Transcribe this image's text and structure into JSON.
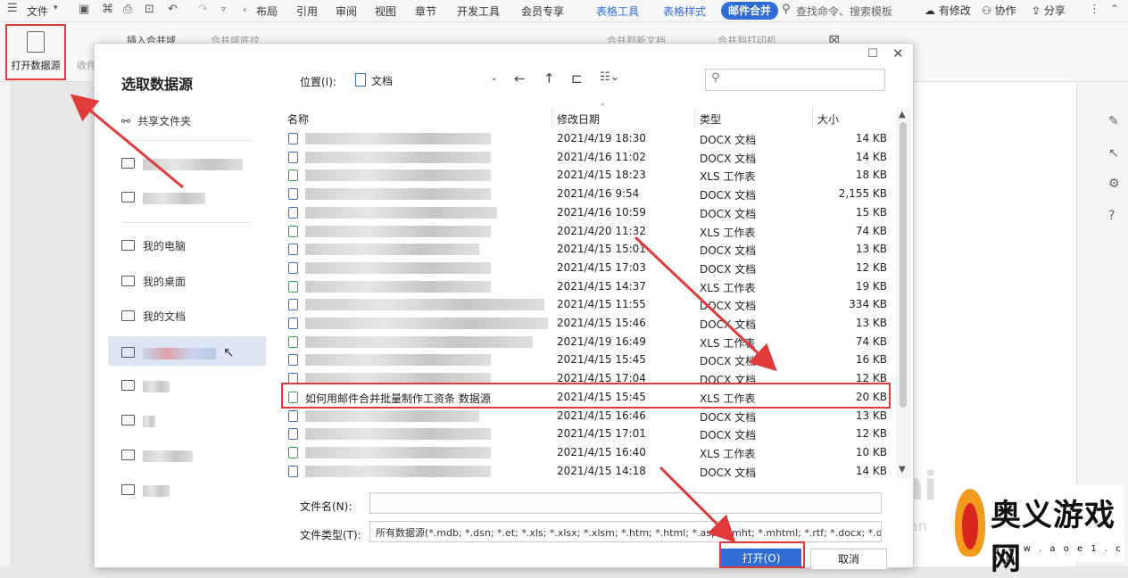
{
  "menubar": {
    "file": "文件",
    "items": [
      "布局",
      "引用",
      "审阅",
      "视图",
      "章节",
      "开发工具",
      "会员专享"
    ],
    "context_tabs": [
      "表格工具",
      "表格样式"
    ],
    "active_tab": "邮件合并",
    "search_placeholder": "查找命令、搜索模板",
    "modified": "有修改",
    "collab": "协作",
    "share": "分享"
  },
  "ribbon": {
    "open_datasource": "打开数据源",
    "collect": "收件",
    "insert_merge_field": "插入合并域",
    "merge_field_shading": "合并域底纹",
    "merge_new_doc": "合并到新文档",
    "merge_printer": "合并到打印机"
  },
  "dialog": {
    "title": "选取数据源",
    "location_label": "位置(I):",
    "location_value": "文档",
    "sidebar": {
      "shared": "共享文件夹",
      "my_computer": "我的电脑",
      "my_desktop": "我的桌面",
      "my_documents": "我的文档"
    },
    "columns": {
      "name": "名称",
      "date": "修改日期",
      "type": "类型",
      "size": "大小"
    },
    "files": [
      {
        "name": "",
        "date": "2021/4/19 18:30",
        "type": "DOCX 文档",
        "size": "14 KB",
        "kind": "docx"
      },
      {
        "name": "",
        "date": "2021/4/16 11:02",
        "type": "DOCX 文档",
        "size": "14 KB",
        "kind": "docx"
      },
      {
        "name": "",
        "date": "2021/4/15 18:23",
        "type": "XLS 工作表",
        "size": "18 KB",
        "kind": "xls"
      },
      {
        "name": "",
        "date": "2021/4/16 9:54",
        "type": "DOCX 文档",
        "size": "2,155 KB",
        "kind": "docx"
      },
      {
        "name": "",
        "date": "2021/4/16 10:59",
        "type": "DOCX 文档",
        "size": "15 KB",
        "kind": "docx"
      },
      {
        "name": "",
        "date": "2021/4/20 11:32",
        "type": "XLS 工作表",
        "size": "74 KB",
        "kind": "xls"
      },
      {
        "name": "",
        "date": "2021/4/15 15:01",
        "type": "DOCX 文档",
        "size": "13 KB",
        "kind": "docx"
      },
      {
        "name": "",
        "date": "2021/4/15 17:03",
        "type": "DOCX 文档",
        "size": "12 KB",
        "kind": "docx"
      },
      {
        "name": "",
        "date": "2021/4/15 14:37",
        "type": "XLS 工作表",
        "size": "19 KB",
        "kind": "xls"
      },
      {
        "name": "",
        "date": "2021/4/15 11:55",
        "type": "DOCX 文档",
        "size": "334 KB",
        "kind": "docx"
      },
      {
        "name": "",
        "date": "2021/4/15 15:46",
        "type": "DOCX 文档",
        "size": "13 KB",
        "kind": "docx"
      },
      {
        "name": "",
        "date": "2021/4/19 16:49",
        "type": "XLS 工作表",
        "size": "74 KB",
        "kind": "xls"
      },
      {
        "name": "",
        "date": "2021/4/15 15:45",
        "type": "DOCX 文档",
        "size": "16 KB",
        "kind": "docx"
      },
      {
        "name": "",
        "date": "2021/4/15 17:04",
        "type": "DOCX 文档",
        "size": "12 KB",
        "kind": "docx"
      },
      {
        "name": "如何用邮件合并批量制作工资条 数据源",
        "date": "2021/4/15 15:45",
        "type": "XLS 工作表",
        "size": "20 KB",
        "kind": "xls"
      },
      {
        "name": "",
        "date": "2021/4/15 16:46",
        "type": "DOCX 文档",
        "size": "13 KB",
        "kind": "docx"
      },
      {
        "name": "",
        "date": "2021/4/15 17:01",
        "type": "DOCX 文档",
        "size": "12 KB",
        "kind": "docx"
      },
      {
        "name": "",
        "date": "2021/4/15 16:40",
        "type": "XLS 工作表",
        "size": "10 KB",
        "kind": "xls"
      },
      {
        "name": "",
        "date": "2021/4/15 14:18",
        "type": "DOCX 文档",
        "size": "14 KB",
        "kind": "docx"
      }
    ],
    "filename_label": "文件名(N):",
    "filename_value": "",
    "filetype_label": "文件类型(T):",
    "filetype_value": "所有数据源(*.mdb; *.dsn; *.et; *.xls; *.xlsx; *.xlsm; *.htm; *.html; *.asp; *.mht; *.mhtml; *.rtf; *.docx; *.doc; *.",
    "open_button": "打开(O)",
    "cancel_button": "取消"
  },
  "watermark": {
    "baidu": "Bai",
    "jingyan": "jingyan"
  },
  "logo": {
    "title": "奥义游戏网",
    "url": "w w w . a o e 1 . c o m"
  },
  "colors": {
    "accent": "#2f6cd8",
    "annotation": "#e03a3a",
    "xls_icon": "#31a05b",
    "docx_icon": "#3a6fc4"
  }
}
